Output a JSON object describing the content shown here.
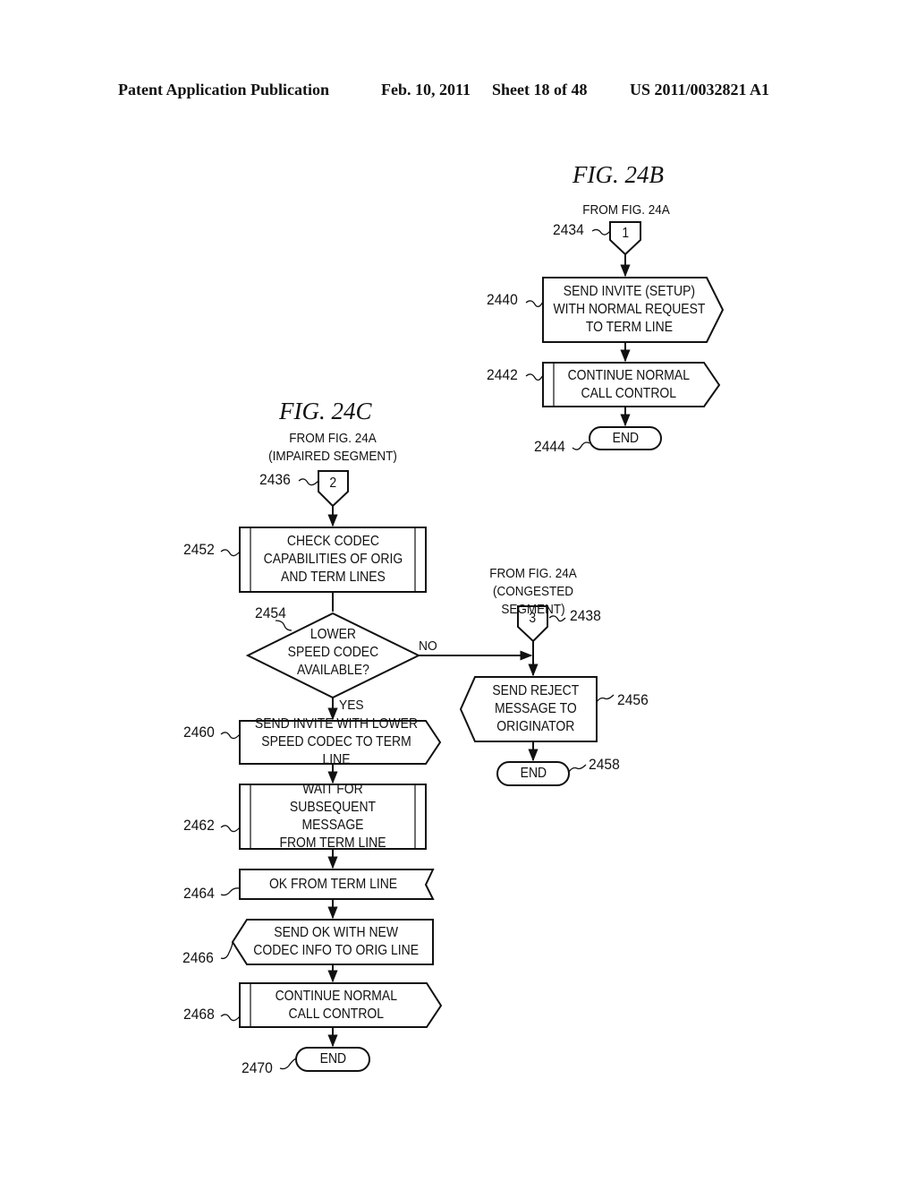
{
  "header": {
    "publication": "Patent Application Publication",
    "date": "Feb. 10, 2011",
    "sheet": "Sheet 18 of 48",
    "number": "US 2011/0032821 A1"
  },
  "fig24b": {
    "title": "FIG. 24B",
    "source_label": "FROM FIG. 24A",
    "connector": {
      "ref": "2434",
      "label": "1"
    },
    "steps": [
      {
        "ref": "2440",
        "text": "SEND INVITE (SETUP)\nWITH NORMAL REQUEST\nTO TERM LINE",
        "shape": "send"
      },
      {
        "ref": "2442",
        "text": "CONTINUE NORMAL\nCALL CONTROL",
        "shape": "predefined-send"
      },
      {
        "ref": "2444",
        "text": "END",
        "shape": "terminator"
      }
    ]
  },
  "fig24c": {
    "title": "FIG. 24C",
    "source_label": "FROM FIG. 24A\n(IMPAIRED SEGMENT)",
    "connector": {
      "ref": "2436",
      "label": "2"
    },
    "steps": [
      {
        "ref": "2452",
        "text": "CHECK CODEC\nCAPABILITIES OF ORIG\nAND TERM LINES",
        "shape": "predefined-process"
      },
      {
        "ref": "2454",
        "text": "LOWER\nSPEED CODEC\nAVAILABLE?",
        "shape": "decision",
        "yes": "YES",
        "no": "NO"
      },
      {
        "ref": "2460",
        "text": "SEND INVITE WITH LOWER\nSPEED CODEC TO TERM LINE",
        "shape": "send"
      },
      {
        "ref": "2462",
        "text": "WAIT FOR\nSUBSEQUENT MESSAGE\nFROM TERM LINE",
        "shape": "predefined-process"
      },
      {
        "ref": "2464",
        "text": "OK FROM TERM LINE",
        "shape": "receive"
      },
      {
        "ref": "2466",
        "text": "SEND OK WITH NEW\nCODEC INFO TO ORIG LINE",
        "shape": "send-left"
      },
      {
        "ref": "2468",
        "text": "CONTINUE NORMAL\nCALL CONTROL",
        "shape": "predefined-send"
      },
      {
        "ref": "2470",
        "text": "END",
        "shape": "terminator"
      }
    ],
    "congested_branch": {
      "source_label": "FROM FIG. 24A\n(CONGESTED SEGMENT)",
      "connector": {
        "ref": "2438",
        "label": "3"
      },
      "steps": [
        {
          "ref": "2456",
          "text": "SEND REJECT\nMESSAGE TO\nORIGINATOR",
          "shape": "send-left"
        },
        {
          "ref": "2458",
          "text": "END",
          "shape": "terminator"
        }
      ]
    }
  }
}
